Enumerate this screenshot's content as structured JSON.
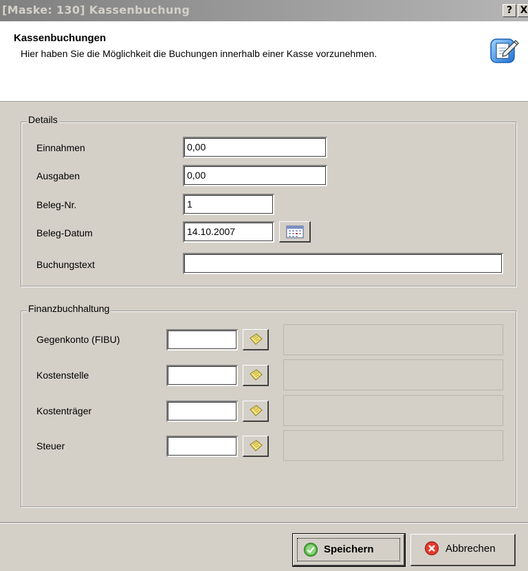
{
  "window": {
    "title": "[Maske: 130]  Kassenbuchung",
    "help_label": "?",
    "close_label": "X"
  },
  "header": {
    "title": "Kassenbuchungen",
    "description": "Hier haben Sie die Möglichkeit die Buchungen innerhalb einer Kasse vorzunehmen."
  },
  "details": {
    "legend": "Details",
    "einnahmen_label": "Einnahmen",
    "einnahmen_value": "0,00",
    "ausgaben_label": "Ausgaben",
    "ausgaben_value": "0,00",
    "beleg_nr_label": "Beleg-Nr.",
    "beleg_nr_value": "1",
    "beleg_datum_label": "Beleg-Datum",
    "beleg_datum_value": "14.10.2007",
    "buchungstext_label": "Buchungstext",
    "buchungstext_value": ""
  },
  "fibu": {
    "legend": "Finanzbuchhaltung",
    "gegenkonto_label": "Gegenkonto (FIBU)",
    "kostenstelle_label": "Kostenstelle",
    "kostentraeger_label": "Kostenträger",
    "steuer_label": "Steuer"
  },
  "footer": {
    "save_label": "Speichern",
    "cancel_label": "Abbrechen"
  }
}
